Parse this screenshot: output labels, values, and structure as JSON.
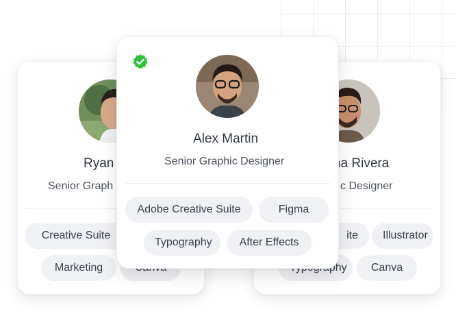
{
  "cards": {
    "left": {
      "name": "Ryan",
      "role": "Senior Graph",
      "chips": [
        "Creative Suite",
        "Marketing",
        "Canva"
      ]
    },
    "center": {
      "name": "Alex Martin",
      "role": "Senior Graphic Designer",
      "verified": true,
      "chips": [
        "Adobe Creative Suite",
        "Figma",
        "Typography",
        "After Effects"
      ]
    },
    "right": {
      "name": "na Rivera",
      "role": "c Designer",
      "chips": [
        "ite",
        "Illustrator",
        "Typography",
        "Canva"
      ]
    }
  },
  "icons": {
    "verified": "verified-badge-icon"
  },
  "colors": {
    "verified_green": "#2fc13a",
    "chip_bg": "#f0f1f4",
    "text_dark": "#30363f"
  }
}
